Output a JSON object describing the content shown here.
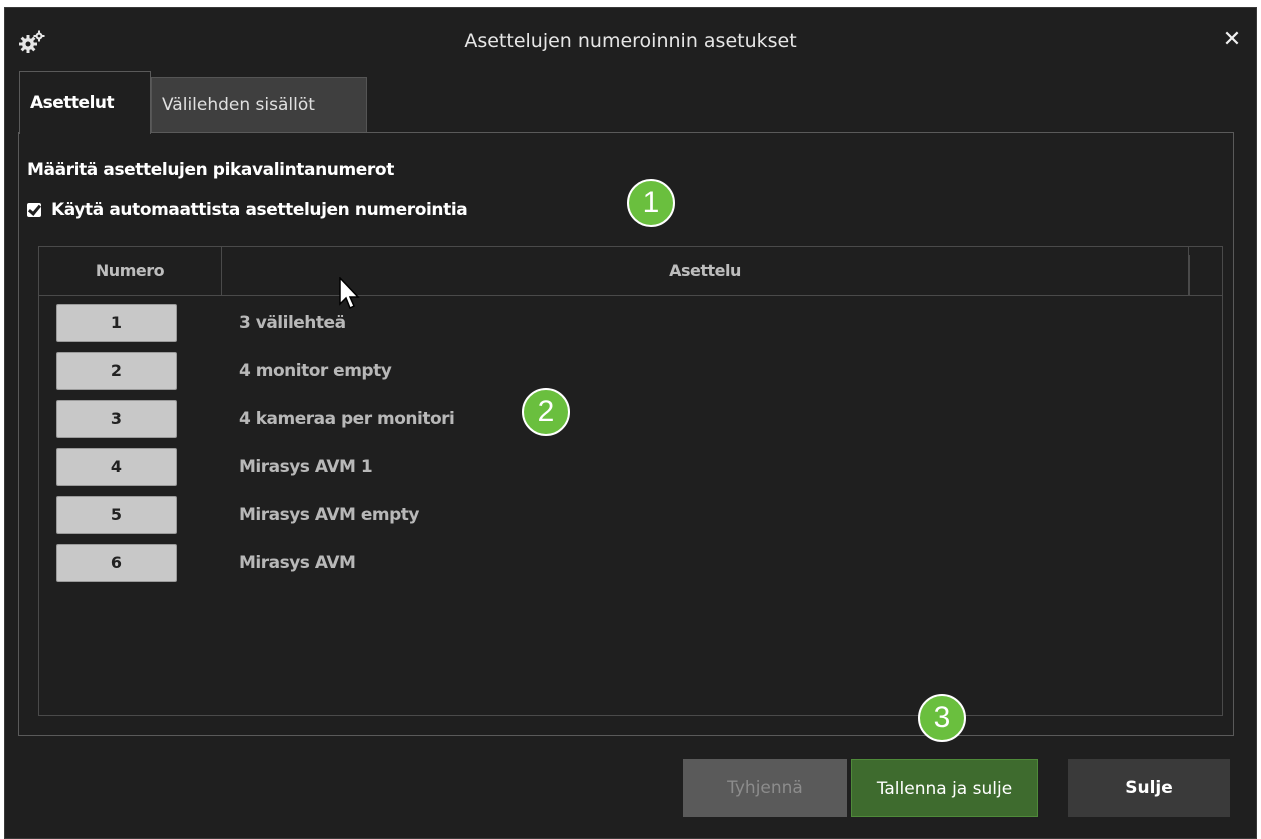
{
  "dialog": {
    "title": "Asettelujen numeroinnin asetukset",
    "close_glyph": "✕",
    "icon": "gears-icon"
  },
  "tabs": [
    {
      "label": "Asettelut",
      "active": true
    },
    {
      "label": "Välilehden sisällöt",
      "active": false
    }
  ],
  "section": {
    "heading": "Määritä asettelujen pikavalintanumerot",
    "auto_numbering_label": "Käytä automaattista asettelujen numerointia",
    "auto_numbering_checked": true
  },
  "table": {
    "columns": [
      "Numero",
      "Asettelu"
    ],
    "rows": [
      {
        "number": "1",
        "layout": "3 välilehteä"
      },
      {
        "number": "2",
        "layout": "4 monitor empty"
      },
      {
        "number": "3",
        "layout": "4 kameraa per monitori"
      },
      {
        "number": "4",
        "layout": "Mirasys AVM 1"
      },
      {
        "number": "5",
        "layout": "Mirasys AVM empty"
      },
      {
        "number": "6",
        "layout": "Mirasys AVM"
      }
    ]
  },
  "markers": [
    "1",
    "2",
    "3"
  ],
  "footer": {
    "clear_label": "Tyhjennä",
    "save_label": "Tallenna ja sulje",
    "close_label": "Sulje"
  },
  "colors": {
    "background": "#1f1f1f",
    "marker_green": "#6abf3e",
    "save_green": "#3e6b2e"
  }
}
